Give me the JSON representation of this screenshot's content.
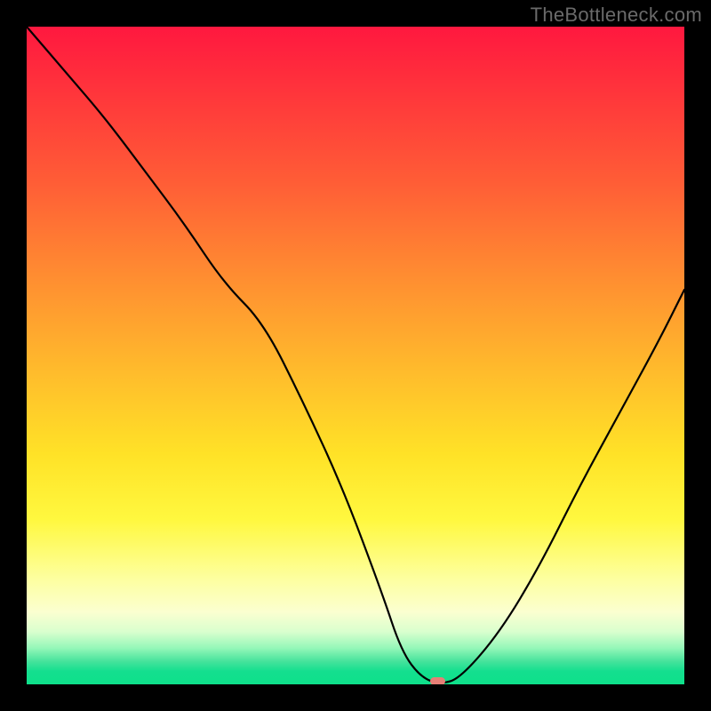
{
  "watermark": "TheBottleneck.com",
  "colors": {
    "black_frame": "#000000",
    "marker": "#e67f76",
    "curve": "#000000"
  },
  "chart_data": {
    "type": "line",
    "title": "",
    "xlabel": "",
    "ylabel": "",
    "xlim": [
      0,
      100
    ],
    "ylim": [
      0,
      100
    ],
    "grid": false,
    "legend": false,
    "series": [
      {
        "name": "bottleneck-curve",
        "x": [
          0,
          6,
          12,
          18,
          24,
          30,
          36,
          42,
          48,
          54,
          57,
          60,
          63,
          66,
          72,
          78,
          84,
          90,
          96,
          100
        ],
        "y": [
          100,
          93,
          86,
          78,
          70,
          61,
          55,
          43,
          30,
          14,
          5,
          1,
          0,
          1,
          8,
          18,
          30,
          41,
          52,
          60
        ]
      }
    ],
    "marker": {
      "name": "recommended-position",
      "x": 62.5,
      "y": 0.5,
      "width_pct": 2.2,
      "height_pct": 1.2
    },
    "gradient_stops_pct": {
      "top_red": 0,
      "orange": 38,
      "yellow": 65,
      "pale": 89,
      "green": 100
    }
  }
}
